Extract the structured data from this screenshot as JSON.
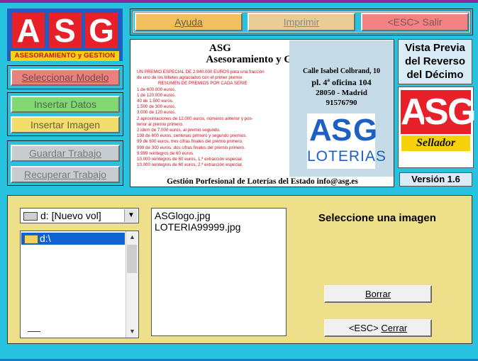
{
  "toolbar": {
    "help": "Ayuda",
    "print": "Imprimir",
    "exit": "<ESC> Salir"
  },
  "logo": {
    "letters": [
      "A",
      "S",
      "G"
    ],
    "caption": "ASESORAMIENTO y GESTION"
  },
  "sidebar": {
    "select_model": "Seleccionar Modelo",
    "insert_data": "Insertar Datos",
    "insert_image": "Insertar Imagen",
    "save_work": "Guardar Trabajo",
    "recover_work": "Recuperar Trabajo"
  },
  "preview": {
    "title": "ASG",
    "subtitle": "Asesoramiento y Gestión",
    "prize_lines": [
      "UN PREMIO ESPECIAL DE 2.940.000 EUROS para una fracción",
      "de uno de los billetes agraciados con el primer premio",
      "RESUMEN DE PREMIOS POR CADA SERIE",
      "1 de 600.000 euros.",
      "1 de 120.000 euros.",
      "40 de 1.500 euros.",
      "1.500 de 300 euros.",
      "3.000 de 120 euros.",
      "2 aproximaciones de 12.000 euros, números anterior y pos-",
      "terior al premio primero.",
      "2 idem de 7.000 euros, al premio segundo.",
      "198 de 600 euros, centenas primero y segundo premios.",
      "99 de 600 euros, tres cifras finales del premio primero.",
      "999 de 300 euros, dos cifras finales del premio primero.",
      "9.999 reintegros de 60 euros.",
      "10.000 reintegros de 60 euros, 1.ª extracción especial.",
      "10.000 reintegros de 60 euros, 2.ª extracción especial."
    ],
    "address": [
      "Calle Isabel Colbrand, 10",
      "pl. 4ª oficina 104",
      "28050 - Madrid",
      "91576790"
    ],
    "lot_letters": [
      "A",
      "S",
      "G"
    ],
    "lot_word": "LOTERIAS",
    "footer": "Gestión Porfesional de Loterías del Estado info@asg.es"
  },
  "right_panel": {
    "vista": [
      "Vista Previa",
      "del Reverso",
      "del Décimo"
    ],
    "sellador_letters": [
      "A",
      "S",
      "G"
    ],
    "sellador_word": "Sellador",
    "version": "Versión 1.6"
  },
  "file_panel": {
    "drive": "d: [Nuevo vol]",
    "dir": "d:\\",
    "files": [
      "ASGlogo.jpg",
      "LOTERIA99999.jpg"
    ],
    "prompt": "Seleccione una imagen",
    "delete": "Borrar",
    "close_pre": "<ESC> ",
    "close_word": "Cerrar"
  },
  "colors": {
    "background": "#27c2dd",
    "help": "#f1c05c",
    "print": "#e9cc94",
    "exit": "#f48282",
    "select_model": "#e9827c",
    "insert_data": "#82d872",
    "insert_image": "#f3de6c",
    "inactive": "#c6ccd0",
    "main_panel": "#eedf8a"
  }
}
